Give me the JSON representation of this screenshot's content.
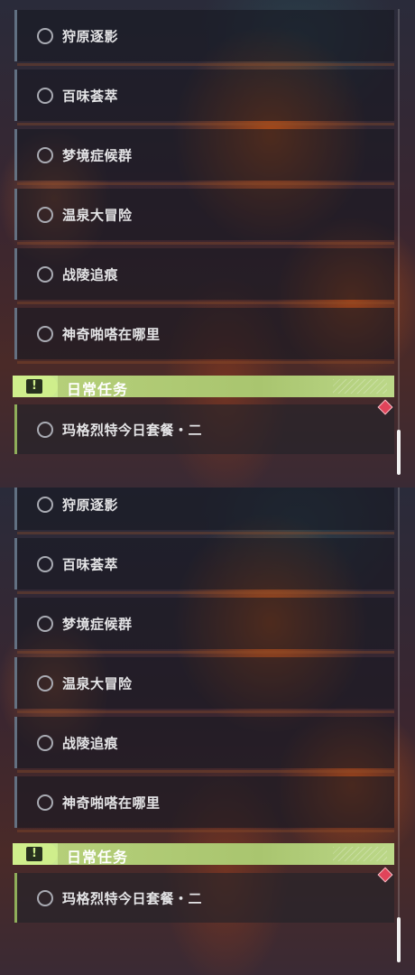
{
  "quest_items": [
    {
      "label": "狩原逐影"
    },
    {
      "label": "百味荟萃"
    },
    {
      "label": "梦境症候群"
    },
    {
      "label": "温泉大冒险"
    },
    {
      "label": "战陵追痕"
    },
    {
      "label": "神奇啪嗒在哪里"
    }
  ],
  "daily_section": {
    "icon": "exclamation-icon",
    "title": "日常任务",
    "items": [
      {
        "label": "玛格烈特今日套餐・二"
      }
    ]
  },
  "colors": {
    "accent_green": "#cfee8c",
    "item_border": "#788ca0",
    "badge_red": "#e0445a"
  }
}
